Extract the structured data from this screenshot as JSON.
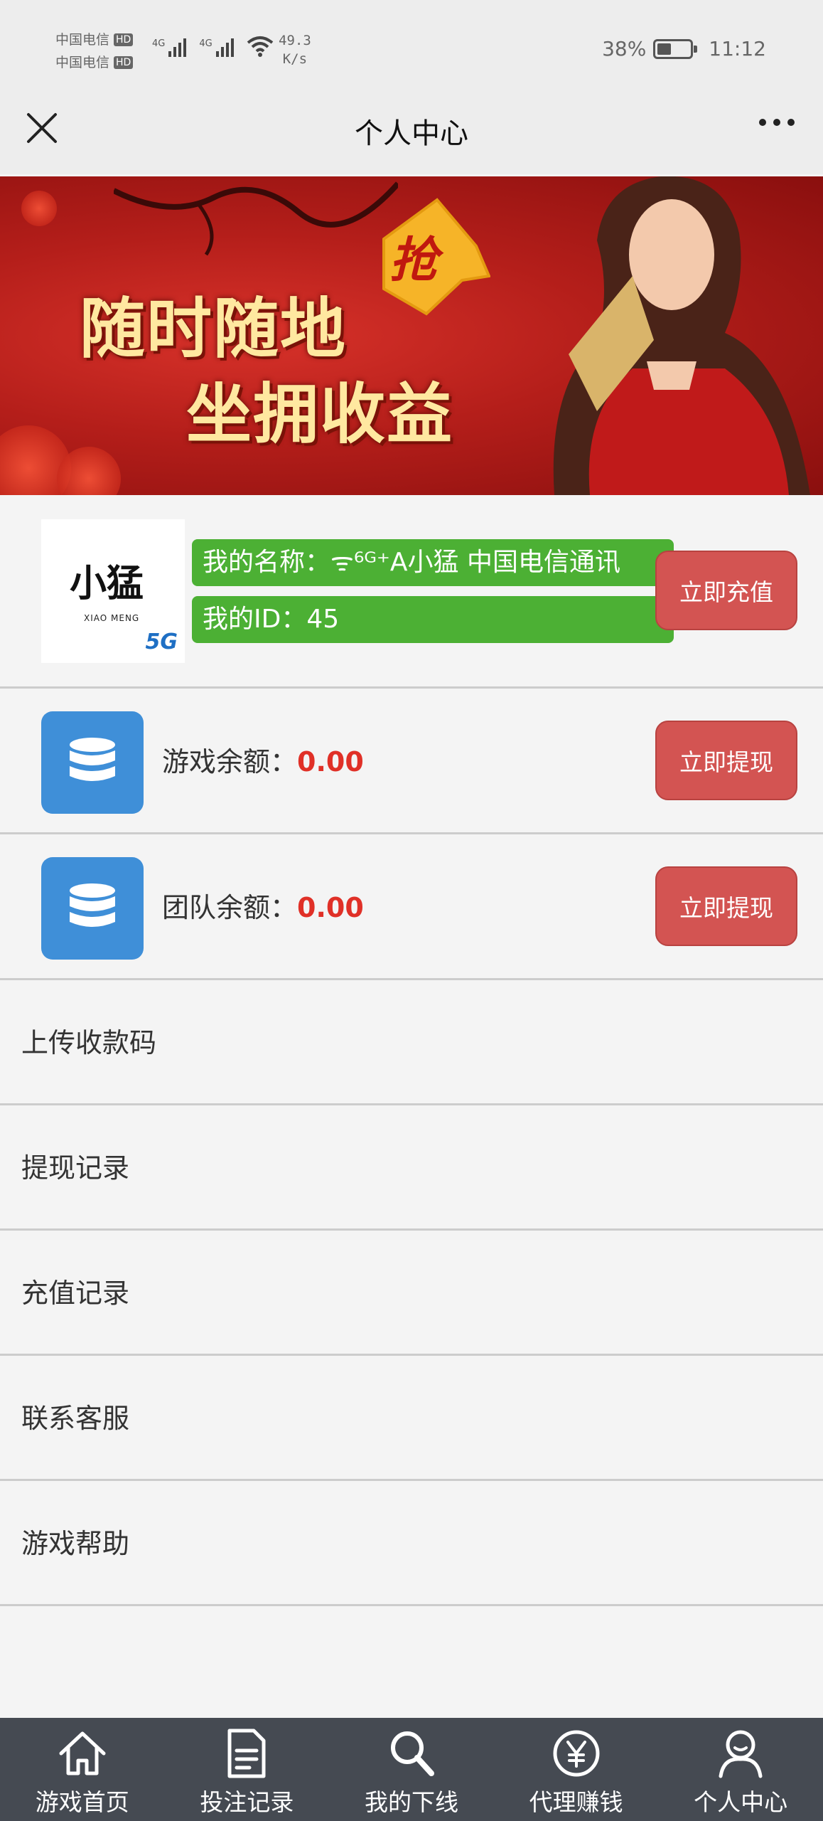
{
  "status_bar": {
    "carrier1": "中国电信",
    "carrier2": "中国电信",
    "hd": "HD",
    "net1": "4G",
    "net2": "4G",
    "speed_value": "49.3",
    "speed_unit": "K/s",
    "battery": "38%",
    "time": "11:12"
  },
  "nav": {
    "title": "个人中心"
  },
  "banner": {
    "line1": "随时随地",
    "line2": "坐拥收益",
    "badge": "抢"
  },
  "profile": {
    "avatar_cn": "小猛",
    "avatar_en": "XIAO MENG",
    "avatar_5g": "5G",
    "name_label": "我的名称：",
    "name_value": "ᯤ⁶ᴳ⁺A小猛 中国电信通讯",
    "id_label": "我的ID：",
    "id_value": "45",
    "recharge_button": "立即充值"
  },
  "balances": [
    {
      "label": "游戏余额：",
      "amount": "0.00",
      "button": "立即提现"
    },
    {
      "label": "团队余额：",
      "amount": "0.00",
      "button": "立即提现"
    }
  ],
  "menu": [
    "上传收款码",
    "提现记录",
    "充值记录",
    "联系客服",
    "游戏帮助"
  ],
  "tabs": [
    {
      "label": "游戏首页",
      "icon": "home-icon"
    },
    {
      "label": "投注记录",
      "icon": "document-icon"
    },
    {
      "label": "我的下线",
      "icon": "search-icon"
    },
    {
      "label": "代理赚钱",
      "icon": "yuan-icon"
    },
    {
      "label": "个人中心",
      "icon": "user-icon"
    }
  ],
  "colors": {
    "accent_green": "#4cb034",
    "button_red": "#d35452",
    "amount_red": "#e03027",
    "icon_blue": "#3f8fd8",
    "tabbar": "#454a52"
  }
}
